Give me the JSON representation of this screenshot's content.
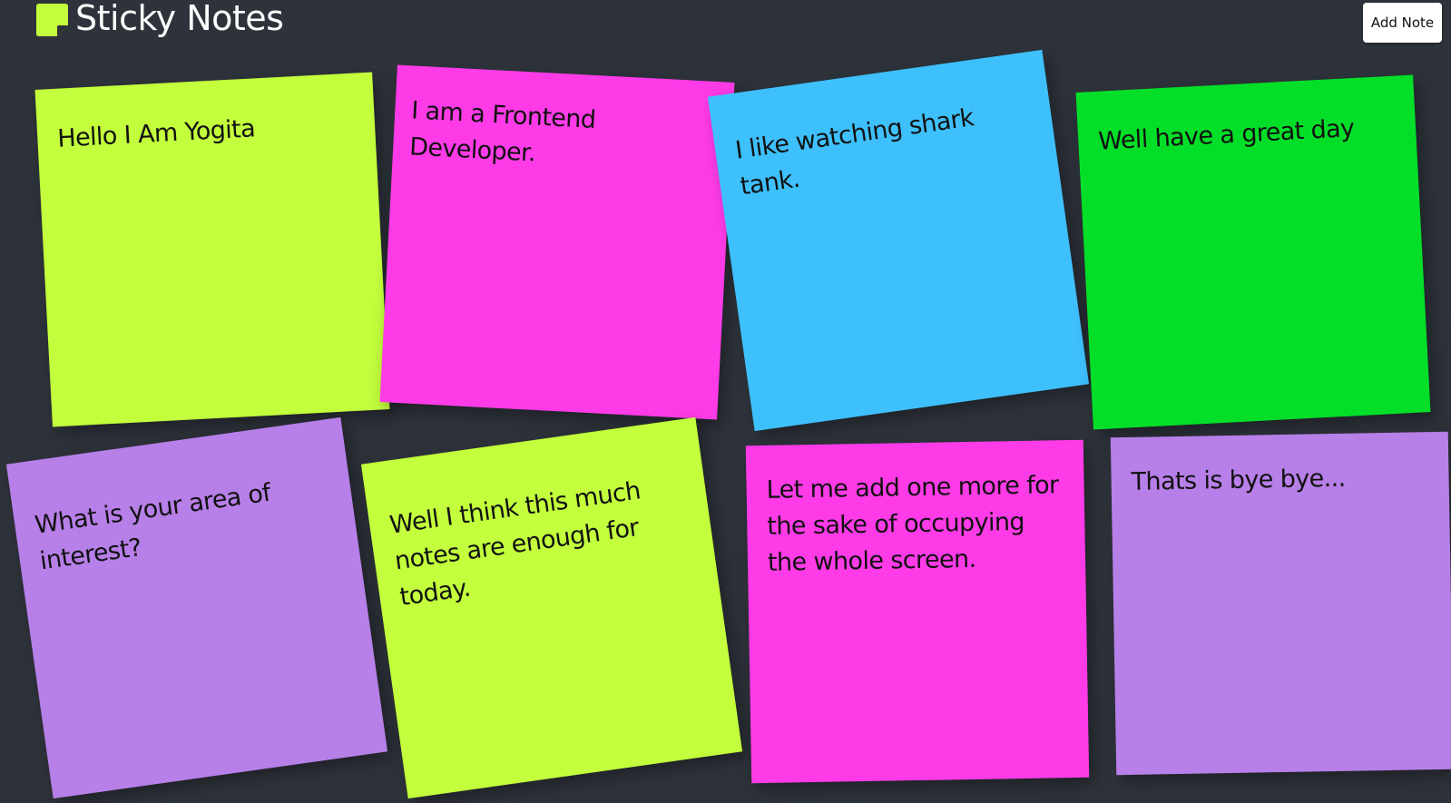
{
  "header": {
    "logo_icon": "sticky-note-icon",
    "title": "Sticky Notes",
    "add_button_label": "Add Note"
  },
  "colors": {
    "background": "#2e333b",
    "lime": "#c3ff3c",
    "magenta": "#ff3be8",
    "sky_blue": "#3ec0fd",
    "green": "#03df28",
    "lavender": "#b77fe8"
  },
  "notes": [
    {
      "text": "Hello I Am Yogita",
      "color": "#c3ff3c"
    },
    {
      "text": "I am a Frontend Developer.",
      "color": "#ff3be8"
    },
    {
      "text": "I like watching shark tank.",
      "color": "#3ec0fd"
    },
    {
      "text": "Well have a great day",
      "color": "#03df28"
    },
    {
      "text": "What is your area of interest?",
      "color": "#b77fe8"
    },
    {
      "text": "Well I think this much notes are enough for today.",
      "color": "#c3ff3c"
    },
    {
      "text": "Let me add one more for the sake of occupying the whole screen.",
      "color": "#ff3be8"
    },
    {
      "text": "Thats is bye bye...",
      "color": "#b77fe8"
    }
  ]
}
